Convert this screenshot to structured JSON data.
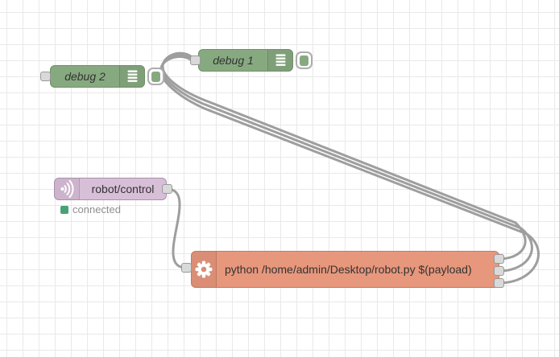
{
  "canvas": {
    "background": "#ffffff",
    "grid_color": "#e9e9e9",
    "wire_color": "#9e9e9e",
    "port_color": "#d9d9d9"
  },
  "nodes": {
    "debug2": {
      "type": "debug",
      "label": "debug 2",
      "icon": "debug-list-icon",
      "color": "#87a980",
      "has_toggle_button": true
    },
    "debug1": {
      "type": "debug",
      "label": "debug 1",
      "icon": "debug-list-icon",
      "color": "#87a980",
      "has_toggle_button": true
    },
    "mqtt": {
      "type": "mqtt in",
      "label": "robot/control",
      "icon": "broadcast-icon",
      "color": "#d8bfd8",
      "status_text": "connected",
      "status_color": "#48a276"
    },
    "exec": {
      "type": "exec",
      "label": "python /home/admin/Desktop/robot.py $(payload)",
      "icon": "gear-icon",
      "color": "#e7977c",
      "outputs": 3
    }
  },
  "wires": [
    {
      "from": "mqtt:out1",
      "to": "exec:in"
    },
    {
      "from": "exec:out1",
      "to": "debug1:in"
    },
    {
      "from": "exec:out2",
      "to": "debug1:in"
    },
    {
      "from": "exec:out3",
      "to": "debug1:in"
    }
  ]
}
